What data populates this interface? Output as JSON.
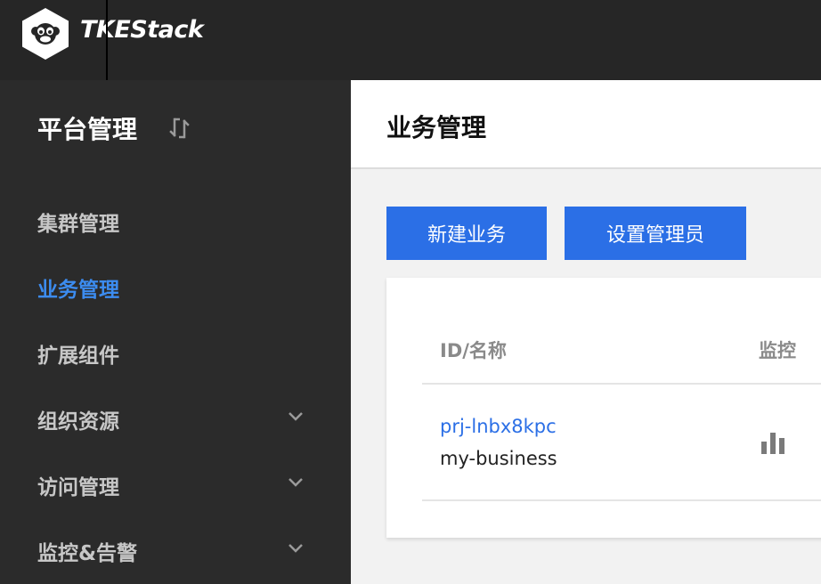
{
  "app": {
    "brand": "TKEStack"
  },
  "sidebar": {
    "title": "平台管理",
    "items": [
      {
        "label": "集群管理",
        "active": false,
        "expandable": false
      },
      {
        "label": "业务管理",
        "active": true,
        "expandable": false
      },
      {
        "label": "扩展组件",
        "active": false,
        "expandable": false
      },
      {
        "label": "组织资源",
        "active": false,
        "expandable": true
      },
      {
        "label": "访问管理",
        "active": false,
        "expandable": true
      },
      {
        "label": "监控&告警",
        "active": false,
        "expandable": true
      }
    ]
  },
  "main": {
    "title": "业务管理",
    "toolbar": {
      "new_label": "新建业务",
      "admin_label": "设置管理员"
    },
    "table": {
      "columns": [
        "ID/名称",
        "监控"
      ],
      "rows": [
        {
          "id": "prj-lnbx8kpc",
          "name": "my-business"
        }
      ]
    }
  },
  "colors": {
    "accent": "#2b6fe6",
    "active_nav": "#3c8cf0",
    "topbar": "#262626",
    "sidebar": "#2b2b2b"
  },
  "icons": {
    "logo": "monkey-face-hexagon-icon",
    "switch": "swap-icon",
    "chevron": "chevron-down-icon",
    "monitor": "bar-chart-icon"
  }
}
